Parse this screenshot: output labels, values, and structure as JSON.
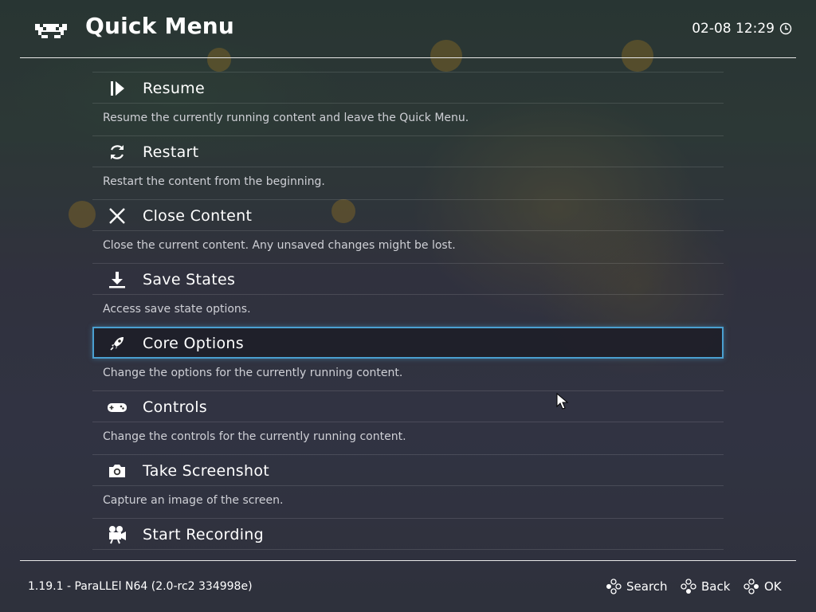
{
  "header": {
    "title": "Quick Menu",
    "datetime": "02-08 12:29",
    "logo_icon": "retroarch-invader-icon",
    "clock_icon": "clock-icon"
  },
  "menu": {
    "items": [
      {
        "label": "Resume",
        "description": "Resume the currently running content and leave the Quick Menu.",
        "icon": "resume-icon"
      },
      {
        "label": "Restart",
        "description": "Restart the content from the beginning.",
        "icon": "restart-icon"
      },
      {
        "label": "Close Content",
        "description": "Close the current content. Any unsaved changes might be lost.",
        "icon": "close-icon"
      },
      {
        "label": "Save States",
        "description": "Access save state options.",
        "icon": "download-icon"
      },
      {
        "label": "Core Options",
        "description": "Change the options for the currently running content.",
        "icon": "rocket-icon"
      },
      {
        "label": "Controls",
        "description": "Change the controls for the currently running content.",
        "icon": "gamepad-icon"
      },
      {
        "label": "Take Screenshot",
        "description": "Capture an image of the screen.",
        "icon": "camera-icon"
      },
      {
        "label": "Start Recording",
        "description": "",
        "icon": "video-camera-icon"
      }
    ],
    "selected_label": "Core Options"
  },
  "footer": {
    "version": "1.19.1 - ParaLLEl N64 (2.0-rc2 334998e)",
    "hints": {
      "search": "Search",
      "back": "Back",
      "ok": "OK"
    }
  },
  "colors": {
    "selection_border": "#4a9fd0",
    "text": "#ffffff",
    "description_text": "#cfd0d6"
  }
}
